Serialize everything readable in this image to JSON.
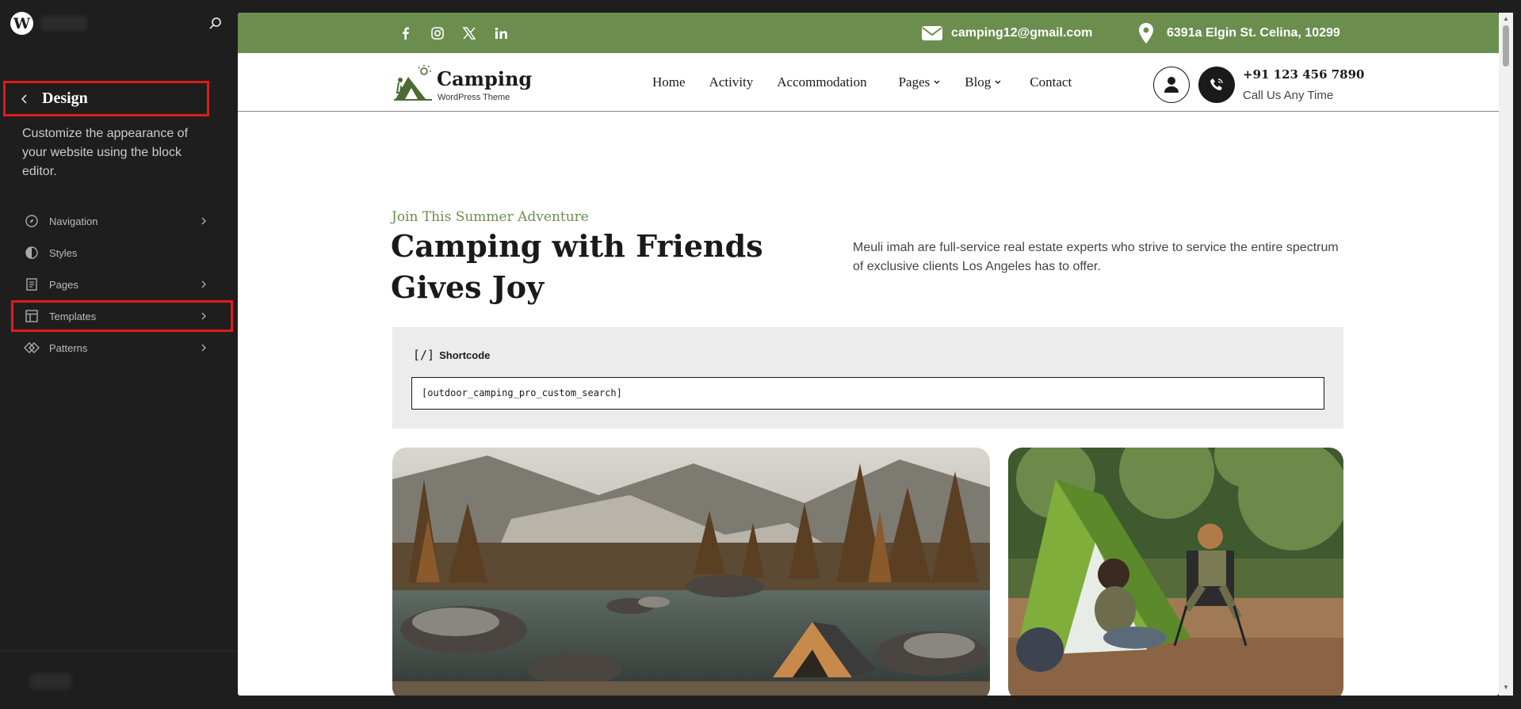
{
  "sidebar": {
    "logo_glyph": "W",
    "design_title": "Design",
    "description": "Customize the appearance of your website using the block editor.",
    "items": [
      {
        "label": "Navigation",
        "icon": "compass-icon",
        "has_chevron": true
      },
      {
        "label": "Styles",
        "icon": "half-circle-icon",
        "has_chevron": false
      },
      {
        "label": "Pages",
        "icon": "page-icon",
        "has_chevron": true
      },
      {
        "label": "Templates",
        "icon": "layout-icon",
        "has_chevron": true
      },
      {
        "label": "Patterns",
        "icon": "diamond-icon",
        "has_chevron": true
      }
    ],
    "highlight_color": "#e01b1b"
  },
  "topbar": {
    "email": "camping12@gmail.com",
    "address": "6391a Elgin St. Celina, 10299",
    "social": [
      "facebook-icon",
      "instagram-icon",
      "x-icon",
      "linkedin-icon"
    ],
    "bg_color": "#6b8e4e"
  },
  "header": {
    "logo_name": "Camping",
    "logo_sub": "WordPress Theme",
    "menu": [
      "Home",
      "Activity",
      "Accommodation",
      "Pages",
      "Blog",
      "Contact"
    ],
    "phone": "+91 123 456 7890",
    "phone_sub": "Call Us Any Time"
  },
  "hero": {
    "eyebrow": "Join This Summer Adventure",
    "title": "Camping with Friends Gives Joy",
    "text": "Meuli imah are full-service real estate experts who strive to service the entire spectrum of exclusive clients Los Angeles has to offer."
  },
  "shortcode": {
    "label": "Shortcode",
    "icon_glyph": "[/]",
    "value": "[outdoor_camping_pro_custom_search]"
  }
}
